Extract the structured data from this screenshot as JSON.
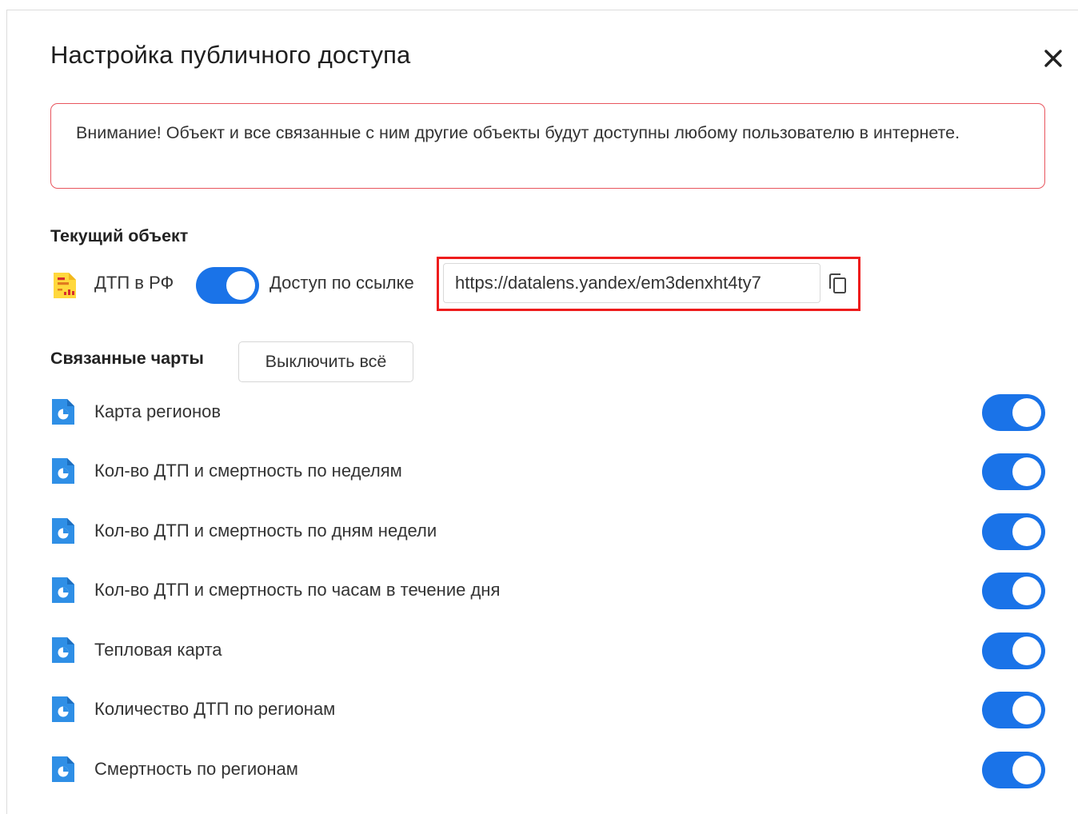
{
  "dialog": {
    "title": "Настройка публичного доступа",
    "close_icon": "close-icon"
  },
  "alert": {
    "text": "Внимание! Объект и все связанные с ним другие объекты будут доступны любому пользователю в интернете.",
    "border_color": "#e8555e"
  },
  "current_object": {
    "section_label": "Текущий объект",
    "icon": "dashboard-icon",
    "name": "ДТП в РФ",
    "toggle_on": true,
    "link_label": "Доступ по ссылке",
    "url": "https://datalens.yandex/em3denxht4ty7",
    "copy_icon": "copy-icon"
  },
  "linked_charts": {
    "section_label": "Связанные чарты",
    "disable_all_label": "Выключить всё",
    "items": [
      {
        "label": "Карта регионов",
        "enabled": true,
        "icon": "chart-icon"
      },
      {
        "label": "Кол-во ДТП и смертность по неделям",
        "enabled": true,
        "icon": "chart-icon"
      },
      {
        "label": "Кол-во ДТП и смертность по дням недели",
        "enabled": true,
        "icon": "chart-icon"
      },
      {
        "label": "Кол-во ДТП и смертность по часам в течение дня",
        "enabled": true,
        "icon": "chart-icon"
      },
      {
        "label": "Тепловая карта",
        "enabled": true,
        "icon": "chart-icon"
      },
      {
        "label": "Количество ДТП по регионам",
        "enabled": true,
        "icon": "chart-icon"
      },
      {
        "label": "Смертность по регионам",
        "enabled": true,
        "icon": "chart-icon"
      }
    ]
  },
  "colors": {
    "accent": "#1a73e8",
    "highlight": "#ee1c1c",
    "dashboard_icon": "#ffd83d",
    "chart_icon": "#2f8fe6"
  }
}
